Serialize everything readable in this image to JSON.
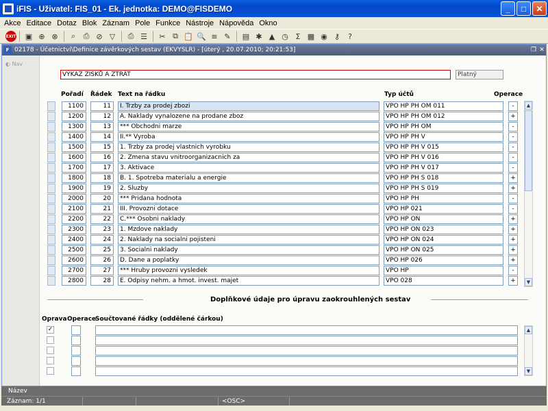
{
  "window": {
    "title": "iFIS - Uživatel: FIS_01 - Ek. jednotka: DEMO@FISDEMO"
  },
  "menu": [
    "Akce",
    "Editace",
    "Dotaz",
    "Blok",
    "Záznam",
    "Pole",
    "Funkce",
    "Nástroje",
    "Nápověda",
    "Okno"
  ],
  "toolbar": {
    "exit_label": "EXIT"
  },
  "form": {
    "title": "02178 - Účetnictví\\Definice závěrkových sestav (EKVYSLR) - [úterý , 20.07.2010; 20:21:53]",
    "nav_label": "Nav",
    "report_name": "VÝKAZ ZISKŮ A ZTRÁT",
    "status": "Platný",
    "headers": {
      "poradi": "Pořadí",
      "radek": "Řádek",
      "text": "Text na řádku",
      "typ": "Typ účtů",
      "operace": "Operace"
    },
    "rows": [
      {
        "poradi": "1100",
        "radek": "11",
        "text": "I.    Trzby za prodej zbozi",
        "typ": "VPO HP PH OM 011",
        "op": "-"
      },
      {
        "poradi": "1200",
        "radek": "12",
        "text": "A.    Naklady vynalozene na prodane zboz",
        "typ": "VPO HP PH OM 012",
        "op": "+"
      },
      {
        "poradi": "1300",
        "radek": "13",
        "text": " *** Obchodni marze",
        "typ": "VPO HP PH OM",
        "op": "-"
      },
      {
        "poradi": "1400",
        "radek": "14",
        "text": "II.** Vyroba",
        "typ": "VPO HP PH V",
        "op": "-"
      },
      {
        "poradi": "1500",
        "radek": "15",
        "text": "  1. Trzby za prodej vlastnich vyrobku",
        "typ": "VPO HP PH V 015",
        "op": "-"
      },
      {
        "poradi": "1600",
        "radek": "16",
        "text": "  2. Zmena stavu vnitroorganizacnich za",
        "typ": "VPO HP PH V 016",
        "op": "-"
      },
      {
        "poradi": "1700",
        "radek": "17",
        "text": "  3. Aktivace",
        "typ": "VPO HP PH V 017",
        "op": "-"
      },
      {
        "poradi": "1800",
        "radek": "18",
        "text": "B. 1. Spotreba materialu a energie",
        "typ": "VPO HP PH S 018",
        "op": "+"
      },
      {
        "poradi": "1900",
        "radek": "19",
        "text": "  2. Sluzby",
        "typ": "VPO HP PH S 019",
        "op": "+"
      },
      {
        "poradi": "2000",
        "radek": "20",
        "text": " *** Pridana hodnota",
        "typ": "VPO HP PH",
        "op": "-"
      },
      {
        "poradi": "2100",
        "radek": "21",
        "text": "III.  Provozni dotace",
        "typ": "VPO HP 021",
        "op": "-"
      },
      {
        "poradi": "2200",
        "radek": "22",
        "text": "C.*** Osobni naklady",
        "typ": "VPO HP ON",
        "op": "+"
      },
      {
        "poradi": "2300",
        "radek": "23",
        "text": "  1. Mzdove naklady",
        "typ": "VPO HP ON 023",
        "op": "+"
      },
      {
        "poradi": "2400",
        "radek": "24",
        "text": "  2. Naklady na socialni pojisteni",
        "typ": "VPO HP ON 024",
        "op": "+"
      },
      {
        "poradi": "2500",
        "radek": "25",
        "text": "  3. Socialni naklady",
        "typ": "VPO HP ON 025",
        "op": "+"
      },
      {
        "poradi": "2600",
        "radek": "26",
        "text": "D.    Dane a poplatky",
        "typ": "VPO HP 026",
        "op": "+"
      },
      {
        "poradi": "2700",
        "radek": "27",
        "text": " *** Hruby provozni vysledek",
        "typ": "VPO HP",
        "op": "-"
      },
      {
        "poradi": "2800",
        "radek": "28",
        "text": "E.    Odpisy nehm. a hmot. invest. majet",
        "typ": "VPO 028",
        "op": "+"
      }
    ],
    "supplementary": {
      "heading": "Doplňkové údaje pro úpravu zaokrouhlených sestav",
      "col_oprava": "Oprava",
      "col_operace": "Operace",
      "col_summed": "Součtované řádky (oddělené čárkou)",
      "rows": [
        {
          "oprava": "✓",
          "operace": "",
          "summed": ""
        },
        {
          "oprava": "",
          "operace": "",
          "summed": ""
        },
        {
          "oprava": "",
          "operace": "",
          "summed": ""
        },
        {
          "oprava": "",
          "operace": "",
          "summed": ""
        },
        {
          "oprava": "",
          "operace": "",
          "summed": ""
        }
      ]
    }
  },
  "statusbar": {
    "field_name": "Název",
    "record": "Záznam: 1/1",
    "osc": "<OSC>"
  }
}
